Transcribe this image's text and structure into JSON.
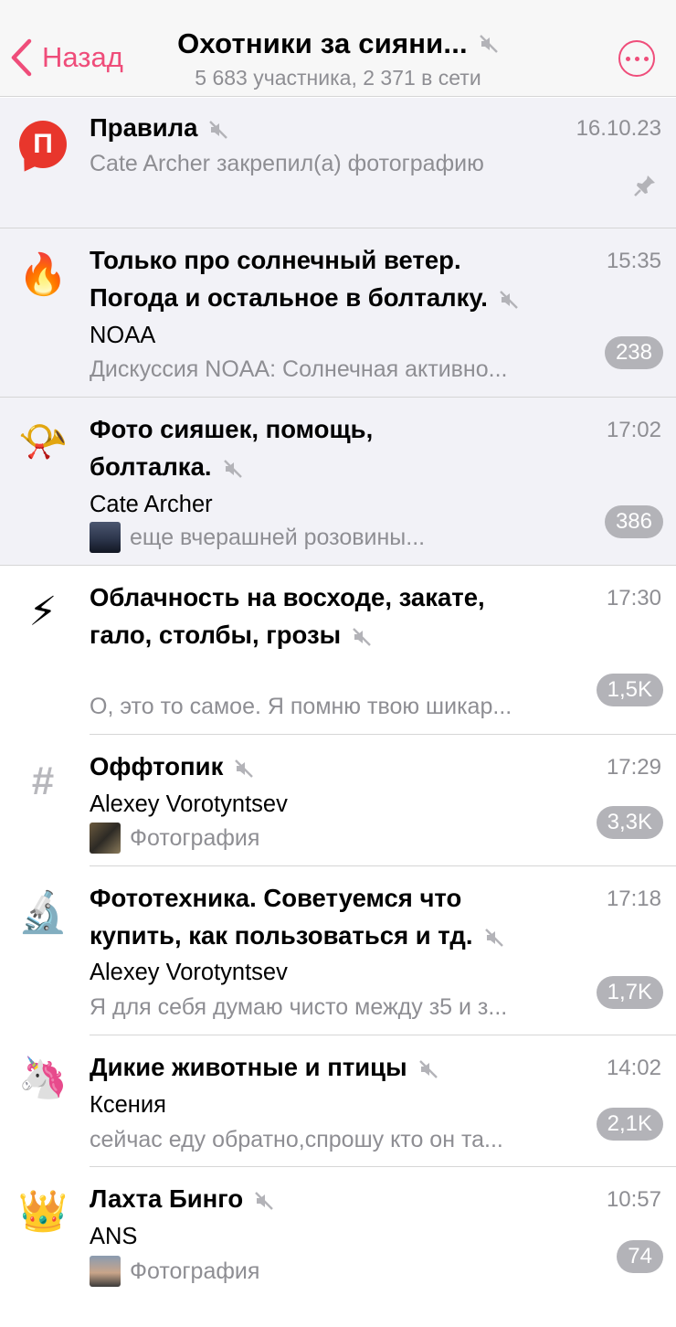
{
  "header": {
    "back_label": "Назад",
    "title": "Охотники за сияни...",
    "subtitle": "5 683 участника, 2 371 в сети",
    "accent_color": "#ef4d7a"
  },
  "topics": [
    {
      "icon": "rules-icon",
      "icon_text": "П",
      "name": "Правила",
      "time": "16.10.23",
      "sender": "",
      "preview": "Cate Archer закрепил(а) фотографию",
      "badge": "",
      "pinned": true,
      "muted": true
    },
    {
      "icon": "fire-icon",
      "icon_text": "🔥",
      "name_line1": "Только про солнечный ветер.",
      "name_line2": "Погода и остальное в болталку.",
      "time": "15:35",
      "sender": "NOAA",
      "preview": "Дискуссия NOAA: Солнечная активно...",
      "badge": "238",
      "muted": true
    },
    {
      "icon": "megaphone-icon",
      "icon_text": "📯",
      "name_line1": "Фото сияшек, помощь,",
      "name_line2": "болталка.",
      "time": "17:02",
      "sender": "Cate Archer",
      "preview": "еще вчерашней розовины...",
      "badge": "386",
      "muted": true,
      "thumb": "night-sky-thumbnail"
    },
    {
      "icon": "lightning-icon",
      "icon_text": "⚡",
      "name_line1": "Облачность на восходе, закате,",
      "name_line2": "гало, столбы, грозы",
      "time": "17:30",
      "sender": "",
      "preview": "О, это то самое. Я помню твою шикар...",
      "badge": "1,5K",
      "muted": true
    },
    {
      "icon": "hash-icon",
      "icon_text": "#",
      "name": "Оффтопик",
      "time": "17:29",
      "sender": "Alexey Vorotyntsev",
      "preview": "Фотография",
      "badge": "3,3K",
      "muted": true,
      "thumb": "photo-thumbnail"
    },
    {
      "icon": "microscope-icon",
      "icon_text": "🔬",
      "name_line1": "Фототехника. Советуемся что",
      "name_line2": "купить, как пользоваться и тд.",
      "time": "17:18",
      "sender": "Alexey Vorotyntsev",
      "preview": "Я для себя думаю чисто между з5 и з...",
      "badge": "1,7K",
      "muted": true
    },
    {
      "icon": "unicorn-icon",
      "icon_text": "🦄",
      "name": "Дикие животные и птицы",
      "time": "14:02",
      "sender": "Ксения",
      "preview": "сейчас еду обратно,спрошу кто он та...",
      "badge": "2,1K",
      "muted": true
    },
    {
      "icon": "crown-icon",
      "icon_text": "👑",
      "name": "Лахта Бинго",
      "time": "10:57",
      "sender": "ANS",
      "preview": "Фотография",
      "badge": "74",
      "muted": true,
      "thumb": "sunset-thumbnail"
    }
  ]
}
